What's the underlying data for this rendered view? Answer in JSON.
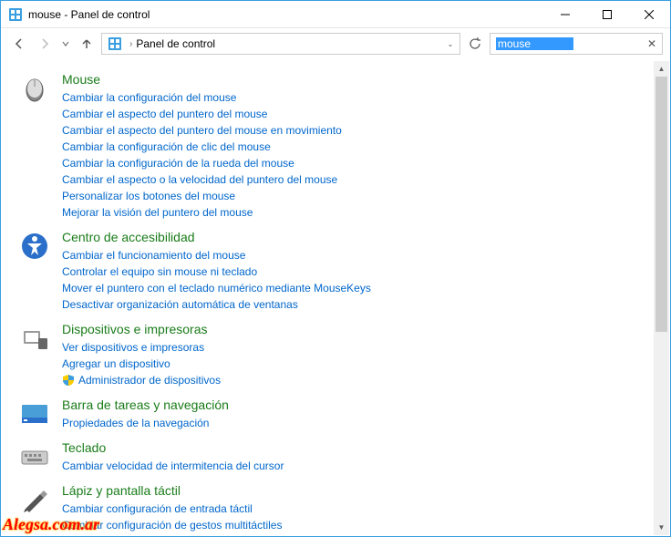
{
  "window": {
    "title": "mouse - Panel de control"
  },
  "address": {
    "text": "Panel de control"
  },
  "search": {
    "value": "mouse"
  },
  "sections": [
    {
      "title": "Mouse",
      "icon": "mouse",
      "links": [
        "Cambiar la configuración del mouse",
        "Cambiar el aspecto del puntero del mouse",
        "Cambiar el aspecto del puntero del mouse en movimiento",
        "Cambiar la configuración de clic del mouse",
        "Cambiar la configuración de la rueda del mouse",
        "Cambiar el aspecto o la velocidad del puntero del mouse",
        "Personalizar los botones del mouse",
        "Mejorar la visión del puntero del mouse"
      ]
    },
    {
      "title": "Centro de accesibilidad",
      "icon": "accessibility",
      "links": [
        "Cambiar el funcionamiento del mouse",
        "Controlar el equipo sin mouse ni teclado",
        "Mover el puntero con el teclado numérico mediante MouseKeys",
        "Desactivar organización automática de ventanas"
      ]
    },
    {
      "title": "Dispositivos e impresoras",
      "icon": "devices",
      "links": [
        "Ver dispositivos e impresoras",
        "Agregar un dispositivo"
      ],
      "shield_link": "Administrador de dispositivos"
    },
    {
      "title": "Barra de tareas y navegación",
      "icon": "taskbar",
      "links": [
        "Propiedades de la navegación"
      ]
    },
    {
      "title": "Teclado",
      "icon": "keyboard",
      "links": [
        "Cambiar velocidad de intermitencia del cursor"
      ]
    },
    {
      "title": "Lápiz y pantalla táctil",
      "icon": "pen",
      "links": [
        "Cambiar configuración de entrada táctil",
        "Cambiar configuración de gestos multitáctiles"
      ]
    }
  ],
  "watermark": "Alegsa.com.ar"
}
